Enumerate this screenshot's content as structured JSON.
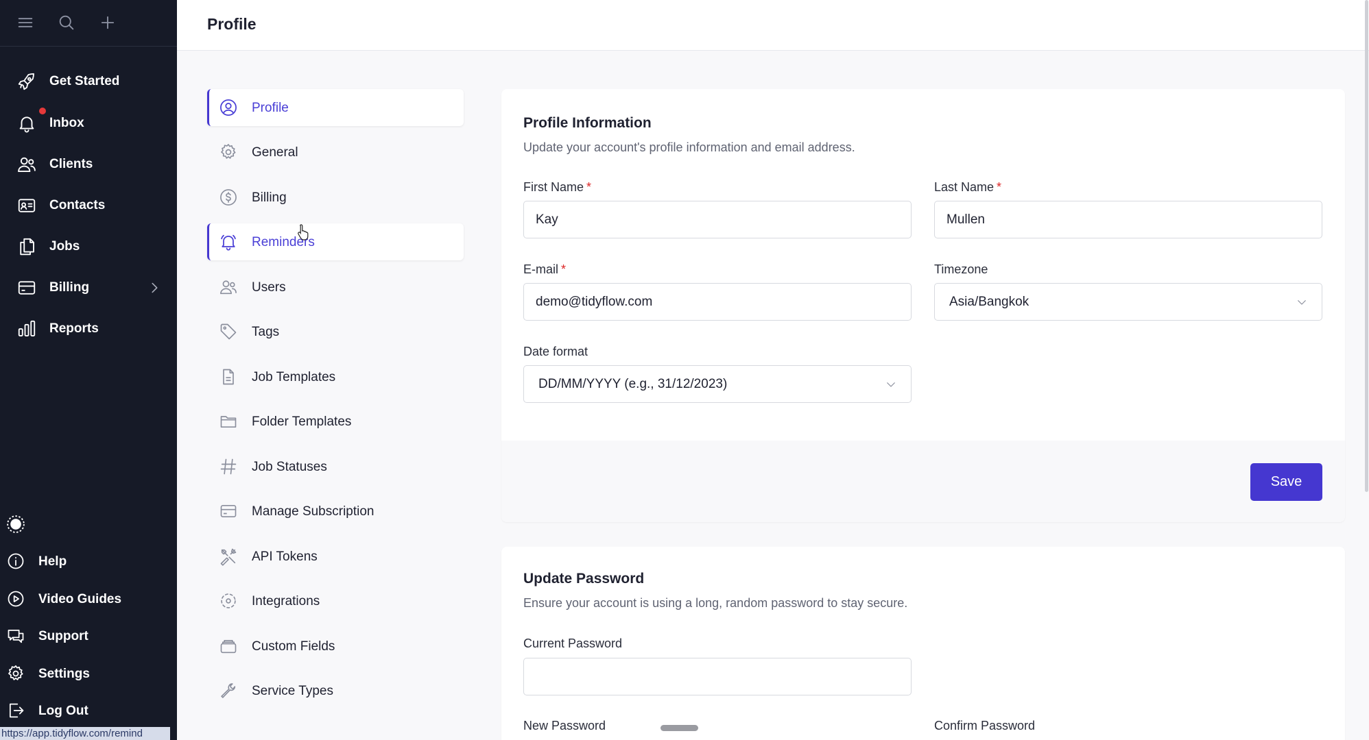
{
  "sidebar": {
    "top_icons": [
      "menu-icon",
      "search-icon",
      "plus-icon"
    ],
    "nav": [
      {
        "label": "Get Started",
        "icon": "rocket-icon"
      },
      {
        "label": "Inbox",
        "icon": "bell-icon",
        "has_unread_dot": true
      },
      {
        "label": "Clients",
        "icon": "users-icon"
      },
      {
        "label": "Contacts",
        "icon": "contact-card-icon"
      },
      {
        "label": "Jobs",
        "icon": "documents-icon"
      },
      {
        "label": "Billing",
        "icon": "credit-card-icon",
        "has_submenu": true
      },
      {
        "label": "Reports",
        "icon": "bar-chart-icon"
      }
    ],
    "footer": [
      {
        "label": "Help",
        "icon": "info-icon"
      },
      {
        "label": "Video Guides",
        "icon": "play-circle-icon"
      },
      {
        "label": "Support",
        "icon": "chat-icon"
      },
      {
        "label": "Settings",
        "icon": "gear-icon"
      },
      {
        "label": "Log Out",
        "icon": "logout-icon"
      }
    ],
    "status_url": "https://app.tidyflow.com/remind"
  },
  "header": {
    "title": "Profile"
  },
  "settings_menu": {
    "items": [
      {
        "label": "Profile",
        "icon": "user-circle-icon",
        "active": true
      },
      {
        "label": "General",
        "icon": "cog-icon"
      },
      {
        "label": "Billing",
        "icon": "dollar-icon"
      },
      {
        "label": "Reminders",
        "icon": "bell-icon",
        "active": true
      },
      {
        "label": "Users",
        "icon": "users-icon"
      },
      {
        "label": "Tags",
        "icon": "tag-icon"
      },
      {
        "label": "Job Templates",
        "icon": "file-icon"
      },
      {
        "label": "Folder Templates",
        "icon": "folder-icon"
      },
      {
        "label": "Job Statuses",
        "icon": "hash-icon"
      },
      {
        "label": "Manage Subscription",
        "icon": "credit-card-icon"
      },
      {
        "label": "API Tokens",
        "icon": "tools-icon"
      },
      {
        "label": "Integrations",
        "icon": "integrations-icon"
      },
      {
        "label": "Custom Fields",
        "icon": "layers-icon"
      },
      {
        "label": "Service Types",
        "icon": "wrench-icon"
      }
    ]
  },
  "profile_info": {
    "title": "Profile Information",
    "subtitle": "Update your account's profile information and email address.",
    "first_name": {
      "label": "First Name",
      "value": "Kay",
      "required": true
    },
    "last_name": {
      "label": "Last Name",
      "value": "Mullen",
      "required": true
    },
    "email": {
      "label": "E-mail",
      "value": "demo@tidyflow.com",
      "required": true
    },
    "timezone": {
      "label": "Timezone",
      "value": "Asia/Bangkok"
    },
    "date_format": {
      "label": "Date format",
      "value": "DD/MM/YYYY (e.g., 31/12/2023)"
    },
    "save_label": "Save",
    "required_mark": "*"
  },
  "update_password": {
    "title": "Update Password",
    "subtitle": "Ensure your account is using a long, random password to stay secure.",
    "current_label": "Current Password",
    "current_value": "",
    "new_label": "New Password",
    "confirm_label": "Confirm Password"
  },
  "colors": {
    "sidebar_bg": "#161a27",
    "accent": "#4537d0",
    "active_text": "#4a3fd6",
    "required": "#dc2626",
    "unread_dot": "#e5393a"
  }
}
